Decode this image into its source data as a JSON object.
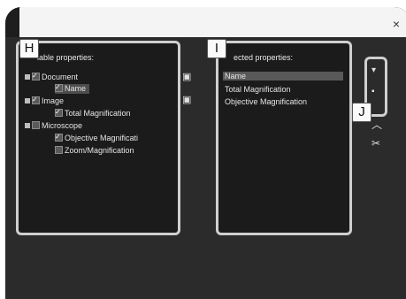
{
  "window": {
    "close_glyph": "×"
  },
  "callouts": {
    "h": "H",
    "i": "I",
    "j": "J"
  },
  "available": {
    "header": "lable properties:",
    "tree": [
      {
        "label": "Document",
        "checked": true
      },
      {
        "label": "Name",
        "checked": true
      },
      {
        "label": "Image",
        "checked": true
      },
      {
        "label": "Total Magnification",
        "checked": true
      },
      {
        "label": "Microscope",
        "checked": false
      },
      {
        "label": "Objective Magnificati",
        "checked": true
      },
      {
        "label": "Zoom/Magnification",
        "checked": false
      }
    ]
  },
  "selected": {
    "header": "ected properties:",
    "items": [
      "Name",
      "Total Magnification",
      "Objective Magnification"
    ]
  },
  "icons": {
    "add": "add-icon",
    "remove": "remove-icon",
    "move_up": "move-up-icon",
    "move_down": "move-down-icon",
    "collapse": "chevron-up-icon",
    "clear": "clear-icon"
  }
}
